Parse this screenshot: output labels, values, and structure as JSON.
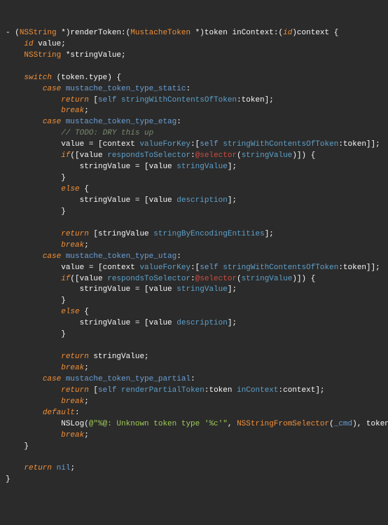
{
  "code": {
    "l1": {
      "dash": "- (",
      "ns1": "NSString",
      "a": " *)renderToken:(",
      "mt": "MustacheToken",
      "b": " *)token inContext:(",
      "idkw": "id",
      "c": ")context {"
    },
    "l2": {
      "idkw": "id",
      "txt": " value;"
    },
    "l3": {
      "ns": "NSString",
      "txt": " *stringValue;"
    },
    "l4": {
      "sw": "switch",
      "txt": " (token.type) {"
    },
    "l5": {
      "cs": "case",
      "sp": " ",
      "en": "mustache_token_type_static",
      "colon": ":"
    },
    "l6": {
      "ret": "return",
      "a": " [",
      "self": "self",
      "b": " ",
      "m": "stringWithContentsOfToken",
      "c": ":token];"
    },
    "l7": {
      "br": "break",
      "semi": ";"
    },
    "l8": {
      "cs": "case",
      "sp": " ",
      "en": "mustache_token_type_etag",
      "colon": ":"
    },
    "l9": {
      "cmt": "// TODO: DRY this up"
    },
    "l10": {
      "a": "value = [context ",
      "m1": "valueForKey",
      "b": ":[",
      "self": "self",
      "c": " ",
      "m2": "stringWithContentsOfToken",
      "d": ":token]];"
    },
    "l11": {
      "if": "if",
      "a": "([value ",
      "m": "respondsToSelector",
      "b": ":",
      "sel": "@selector",
      "c": "(",
      "sv": "stringValue",
      "d": ")]) {"
    },
    "l12": {
      "a": "stringValue = [value ",
      "m": "stringValue",
      "b": "];"
    },
    "l13": {
      "brace": "}"
    },
    "l14": {
      "else": "else",
      "brace": " {"
    },
    "l15": {
      "a": "stringValue = [value ",
      "m": "description",
      "b": "];"
    },
    "l16": {
      "brace": "}"
    },
    "l17": {
      "ret": "return",
      "a": " [stringValue ",
      "m": "stringByEncodingEntities",
      "b": "];"
    },
    "l18": {
      "br": "break",
      "semi": ";"
    },
    "l19": {
      "cs": "case",
      "sp": " ",
      "en": "mustache_token_type_utag",
      "colon": ":"
    },
    "l20": {
      "a": "value = [context ",
      "m1": "valueForKey",
      "b": ":[",
      "self": "self",
      "c": " ",
      "m2": "stringWithContentsOfToken",
      "d": ":token]];"
    },
    "l21": {
      "if": "if",
      "a": "([value ",
      "m": "respondsToSelector",
      "b": ":",
      "sel": "@selector",
      "c": "(",
      "sv": "stringValue",
      "d": ")]) {"
    },
    "l22": {
      "a": "stringValue = [value ",
      "m": "stringValue",
      "b": "];"
    },
    "l23": {
      "brace": "}"
    },
    "l24": {
      "else": "else",
      "brace": " {"
    },
    "l25": {
      "a": "stringValue = [value ",
      "m": "description",
      "b": "];"
    },
    "l26": {
      "brace": "}"
    },
    "l27": {
      "ret": "return",
      "txt": " stringValue;"
    },
    "l28": {
      "br": "break",
      "semi": ";"
    },
    "l29": {
      "cs": "case",
      "sp": " ",
      "en": "mustache_token_type_partial",
      "colon": ":"
    },
    "l30": {
      "ret": "return",
      "a": " [",
      "self": "self",
      "b": " ",
      "m1": "renderPartialToken",
      "c": ":token ",
      "m2": "inContext",
      "d": ":context];"
    },
    "l31": {
      "br": "break",
      "semi": ";"
    },
    "l32": {
      "def": "default",
      "colon": ":"
    },
    "l33": {
      "a": "NSLog(",
      "str": "@\"%@: Unknown token type '%c'\"",
      "b": ", ",
      "fn": "NSStringFromSelector",
      "c": "(",
      "cmd": "_cmd",
      "d": "), token.type);"
    },
    "l34": {
      "br": "break",
      "semi": ";"
    },
    "l35": {
      "brace": "}"
    },
    "l36": {
      "ret": "return",
      "sp": " ",
      "nil": "nil",
      "semi": ";"
    },
    "l37": {
      "brace": "}"
    }
  }
}
